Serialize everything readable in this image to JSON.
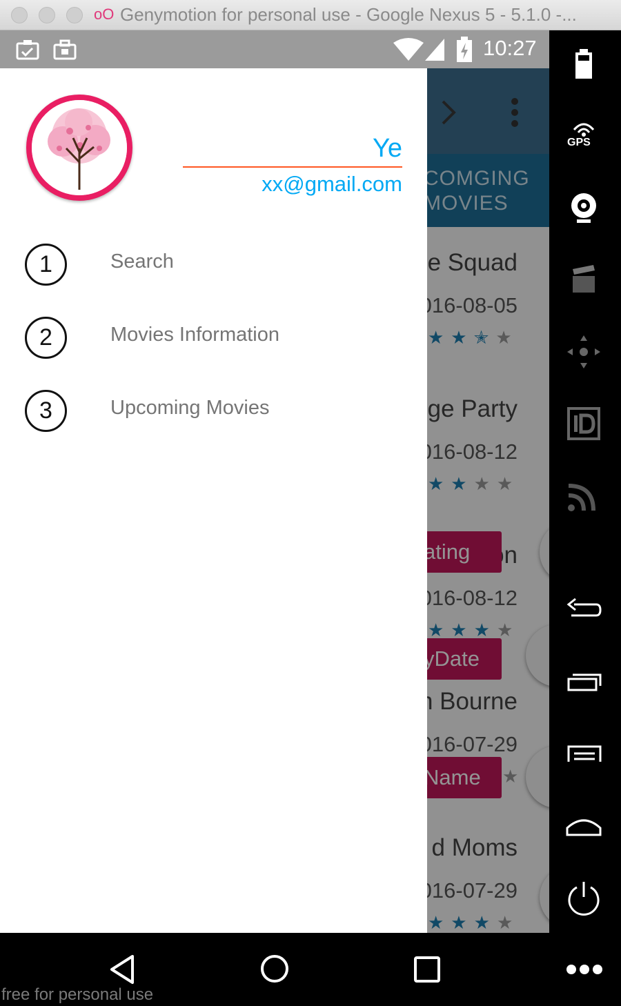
{
  "window": {
    "title": "Genymotion for personal use - Google Nexus 5 - 5.1.0 -...",
    "logo_text": "oO"
  },
  "status_bar": {
    "time": "10:27",
    "background_color": "#9b9b9b"
  },
  "background_app": {
    "tab_label_line1": "COMGING",
    "tab_label_line2": "MOVIES",
    "toolbar_color": "#3d6f8f",
    "tab_color": "#1e6f98",
    "list": [
      {
        "title": "le Squad",
        "date": "016-08-05",
        "rating": 2.5
      },
      {
        "title": "ge Party",
        "date": "016-08-12",
        "rating": 2
      },
      {
        "title": "on",
        "date": "016-08-12",
        "rating": 3
      },
      {
        "title": "n Bourne",
        "date": "016-07-29",
        "rating": 0
      },
      {
        "title": "d Moms",
        "date": "016-07-29",
        "rating": 3
      }
    ],
    "sort_chips": [
      "ating",
      "yDate",
      "Name"
    ],
    "chip_color": "#c2185b"
  },
  "drawer": {
    "user_name": "Ye",
    "user_email": "xx@gmail.com",
    "accent_color": "#03a9f4",
    "avatar_border_color": "#e91e63",
    "menu": [
      {
        "number": "1",
        "label": "Search"
      },
      {
        "number": "2",
        "label": "Movies Information"
      },
      {
        "number": "3",
        "label": "Upcoming Movies"
      }
    ]
  },
  "genymotion_sidebar": {
    "gps_label": "GPS",
    "icons": [
      "battery-icon",
      "gps-icon",
      "webcam-icon",
      "clapperboard-icon",
      "dpad-icon",
      "id-icon",
      "cast-icon",
      "back-icon",
      "recents-icon",
      "menu-icon",
      "home-icon",
      "power-icon"
    ]
  },
  "navigation_bar": {
    "icons": [
      "nav-back-icon",
      "nav-home-icon",
      "nav-recents-icon",
      "more-icon"
    ]
  },
  "watermark": "free for personal use"
}
